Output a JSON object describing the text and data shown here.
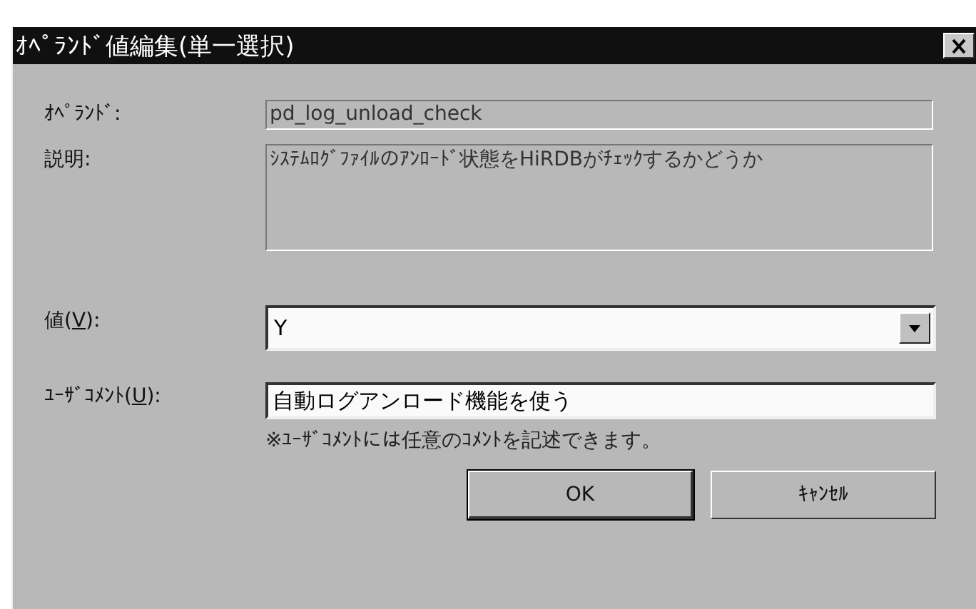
{
  "window": {
    "title": "ｵﾍﾟﾗﾝﾄﾞ値編集(単一選択)"
  },
  "fields": [
    {
      "kind": "readonly",
      "label_before": "ｵﾍﾟﾗﾝﾄﾞ:",
      "value": "pd_log_unload_check"
    },
    {
      "kind": "multiline",
      "label_before": "説明:",
      "value": "ｼｽﾃﾑﾛｸﾞﾌｧｲﾙのｱﾝﾛｰﾄﾞ状態をHiRDBがﾁｪｯｸするかどうか"
    },
    {
      "kind": "combo",
      "label_before": "値(",
      "access_key": "V",
      "label_after": "):",
      "value": "Y"
    },
    {
      "kind": "input",
      "label_before": "ﾕｰｻﾞｺﾒﾝﾄ(",
      "access_key": "U",
      "label_after": "):",
      "value": "自動ログアンロード機能を使う"
    }
  ],
  "note": "※ﾕｰｻﾞｺﾒﾝﾄには任意のｺﾒﾝﾄを記述できます。",
  "buttons": [
    {
      "label": "OK",
      "default": true
    },
    {
      "label": "ｷｬﾝｾﾙ",
      "default": false
    }
  ]
}
